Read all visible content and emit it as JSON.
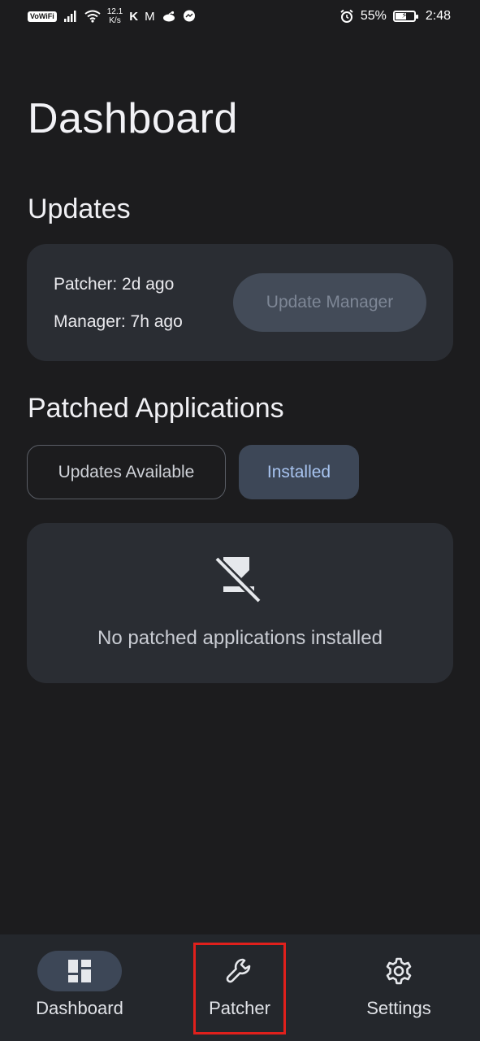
{
  "status_bar": {
    "vowifi": "VoWiFi",
    "net_speed_value": "12.1",
    "net_speed_unit": "K/s",
    "notif_k": "K",
    "notif_m": "M",
    "battery_percent": "55%",
    "time": "2:48",
    "icons": [
      "signal-icon",
      "wifi-icon",
      "gmail-icon",
      "reddit-icon",
      "messenger-icon",
      "alarm-icon",
      "battery-charging-icon"
    ]
  },
  "page": {
    "title": "Dashboard"
  },
  "updates": {
    "title": "Updates",
    "patcher_status": "Patcher: 2d ago",
    "manager_status": "Manager: 7h ago",
    "update_button_label": "Update Manager"
  },
  "patched": {
    "title": "Patched Applications",
    "chips": [
      {
        "label": "Updates Available",
        "selected": false
      },
      {
        "label": "Installed",
        "selected": true
      }
    ],
    "empty_icon": "no-apps-icon",
    "empty_message": "No patched applications installed"
  },
  "bottom_nav": {
    "items": [
      {
        "label": "Dashboard",
        "icon": "dashboard-icon",
        "active": true
      },
      {
        "label": "Patcher",
        "icon": "wrench-icon",
        "active": false
      },
      {
        "label": "Settings",
        "icon": "gear-icon",
        "active": false
      }
    ]
  },
  "colors": {
    "background": "#1c1c1e",
    "card": "#2a2d33",
    "selected_chip": "#3d4757",
    "selected_chip_text": "#a8c4f0",
    "highlight": "#e0201c"
  }
}
